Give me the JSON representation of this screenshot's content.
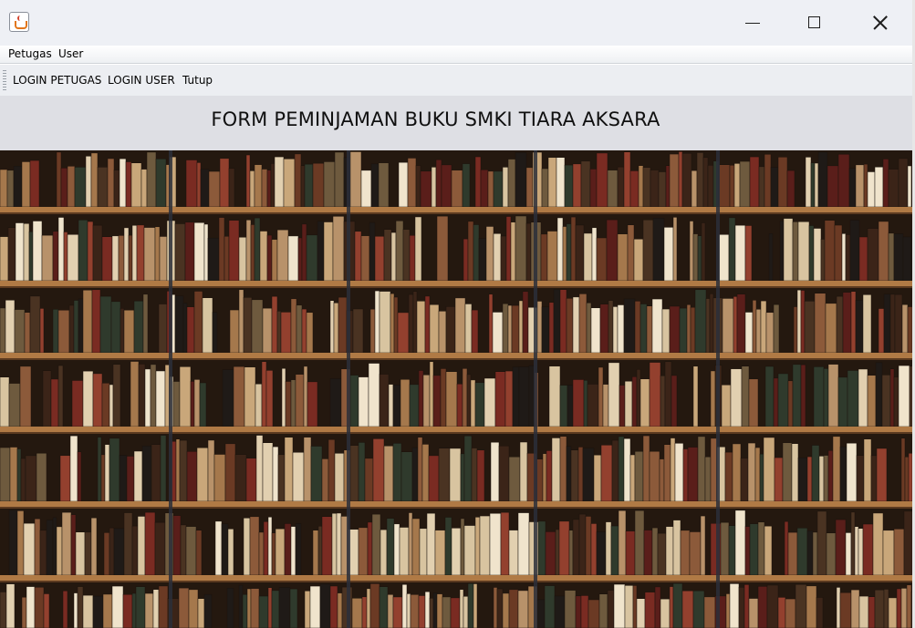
{
  "window": {
    "controls": {
      "minimize": "minimize",
      "maximize": "maximize",
      "close": "close"
    }
  },
  "menubar": {
    "items": [
      "Petugas",
      "User"
    ]
  },
  "toolbar": {
    "buttons": [
      "LOGIN PETUGAS",
      "LOGIN USER",
      "Tutup"
    ]
  },
  "header": {
    "title": "FORM PEMINJAMAN BUKU SMKI TIARA AKSARA"
  },
  "colors": {
    "titlebar": "#eef0f5",
    "header": "#dedfe4",
    "shelf": "#b07a45",
    "shelf_shadow": "#2a1d15"
  },
  "icons": {
    "app": "java-cup-icon",
    "minimize": "minimize-icon",
    "maximize": "maximize-icon",
    "close": "close-icon"
  }
}
